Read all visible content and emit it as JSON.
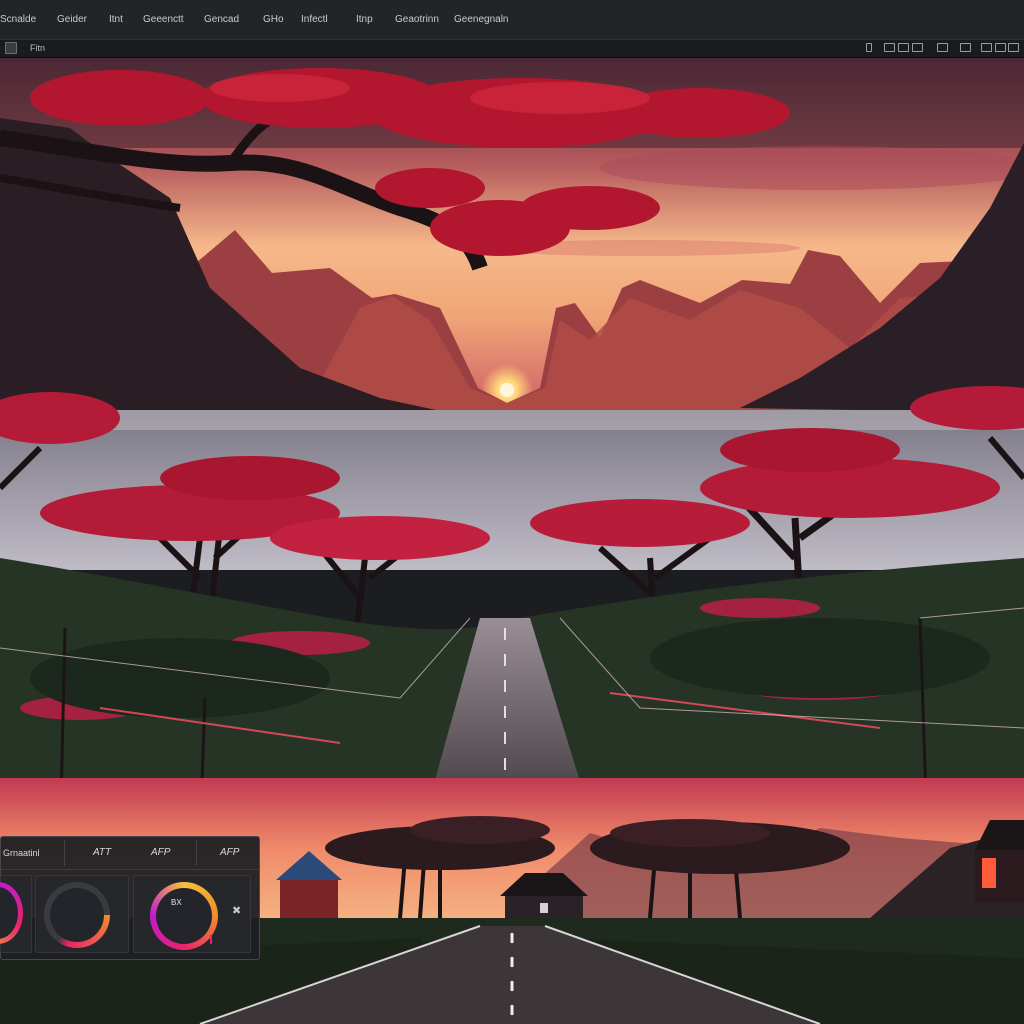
{
  "menu": {
    "items": [
      "Scnalde",
      "Geider",
      "Itnt",
      "Geeenctt",
      "Gencad",
      "GHo",
      "Infectl",
      "Itnp",
      "Geaotrinn",
      "Geenegnaln"
    ]
  },
  "toolbar": {
    "label": "Fitn",
    "right_icons": [
      "panel-icon",
      "window-icon",
      "window-icon",
      "window-icon",
      "window-icon",
      "window-icon",
      "window-icon",
      "window-icon"
    ]
  },
  "color_panel": {
    "title": "Grnaatinl",
    "tabs": [
      "ATT",
      "AFP",
      "AFP"
    ],
    "wheel_value": "BX",
    "add_icon": "add-point-icon",
    "colors": {
      "wheel_a": "#c11ad0",
      "wheel_b": "#f28a2e",
      "wheel_c": "#e8246a",
      "wheel_d": "#f4c23a"
    }
  },
  "scene": {
    "subject": "sunset-landscape-image",
    "colors": {
      "sky_top": "#5a2a3a",
      "sky_glow": "#f6b98a",
      "foliage": "#c01f3f",
      "hills": "#2b2226"
    }
  }
}
